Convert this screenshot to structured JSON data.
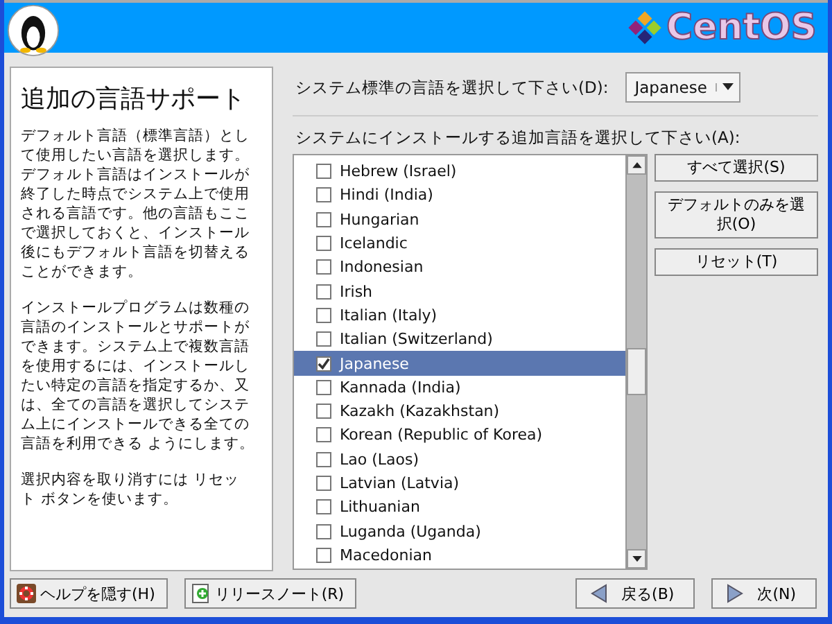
{
  "banner": {
    "brand": "CentOS"
  },
  "help": {
    "title": "追加の言語サポート",
    "paragraphs": [
      "デフォルト言語（標準言語）として使用したい言語を選択します。デフォルト言語はインストールが終了した時点でシステム上で使用される言語です。他の言語もここで選択しておくと、インストール後にもデフォルト言語を切替えることができます。",
      "インストールプログラムは数種の言語のインストールとサポートができます。システム上で複数言語を使用するには、インストールしたい特定の言語を指定するか、又は、全ての言語を選択してシステム上にインストールできる全ての言語を利用できる ようにします。",
      "選択内容を取り消すには リセット ボタンを使います。"
    ]
  },
  "default_language": {
    "label": "システム標準の言語を選択して下さい(D):",
    "value": "Japanese"
  },
  "additional": {
    "label": "システムにインストールする追加言語を選択して下さい(A):",
    "items": [
      {
        "label": "Hebrew (Israel)",
        "checked": false,
        "selected": false
      },
      {
        "label": "Hindi (India)",
        "checked": false,
        "selected": false
      },
      {
        "label": "Hungarian",
        "checked": false,
        "selected": false
      },
      {
        "label": "Icelandic",
        "checked": false,
        "selected": false
      },
      {
        "label": "Indonesian",
        "checked": false,
        "selected": false
      },
      {
        "label": "Irish",
        "checked": false,
        "selected": false
      },
      {
        "label": "Italian (Italy)",
        "checked": false,
        "selected": false
      },
      {
        "label": "Italian (Switzerland)",
        "checked": false,
        "selected": false
      },
      {
        "label": "Japanese",
        "checked": true,
        "selected": true
      },
      {
        "label": "Kannada (India)",
        "checked": false,
        "selected": false
      },
      {
        "label": "Kazakh (Kazakhstan)",
        "checked": false,
        "selected": false
      },
      {
        "label": "Korean (Republic of Korea)",
        "checked": false,
        "selected": false
      },
      {
        "label": "Lao (Laos)",
        "checked": false,
        "selected": false
      },
      {
        "label": "Latvian (Latvia)",
        "checked": false,
        "selected": false
      },
      {
        "label": "Lithuanian",
        "checked": false,
        "selected": false
      },
      {
        "label": "Luganda (Uganda)",
        "checked": false,
        "selected": false
      },
      {
        "label": "Macedonian",
        "checked": false,
        "selected": false
      }
    ],
    "buttons": [
      "すべて選択(S)",
      "デフォルトのみを選択(O)",
      "リセット(T)"
    ]
  },
  "footer": {
    "help_button": "ヘルプを隠す(H)",
    "notes_button": "リリースノート(R)",
    "back_button": "戻る(B)",
    "next_button": "次(N)"
  }
}
